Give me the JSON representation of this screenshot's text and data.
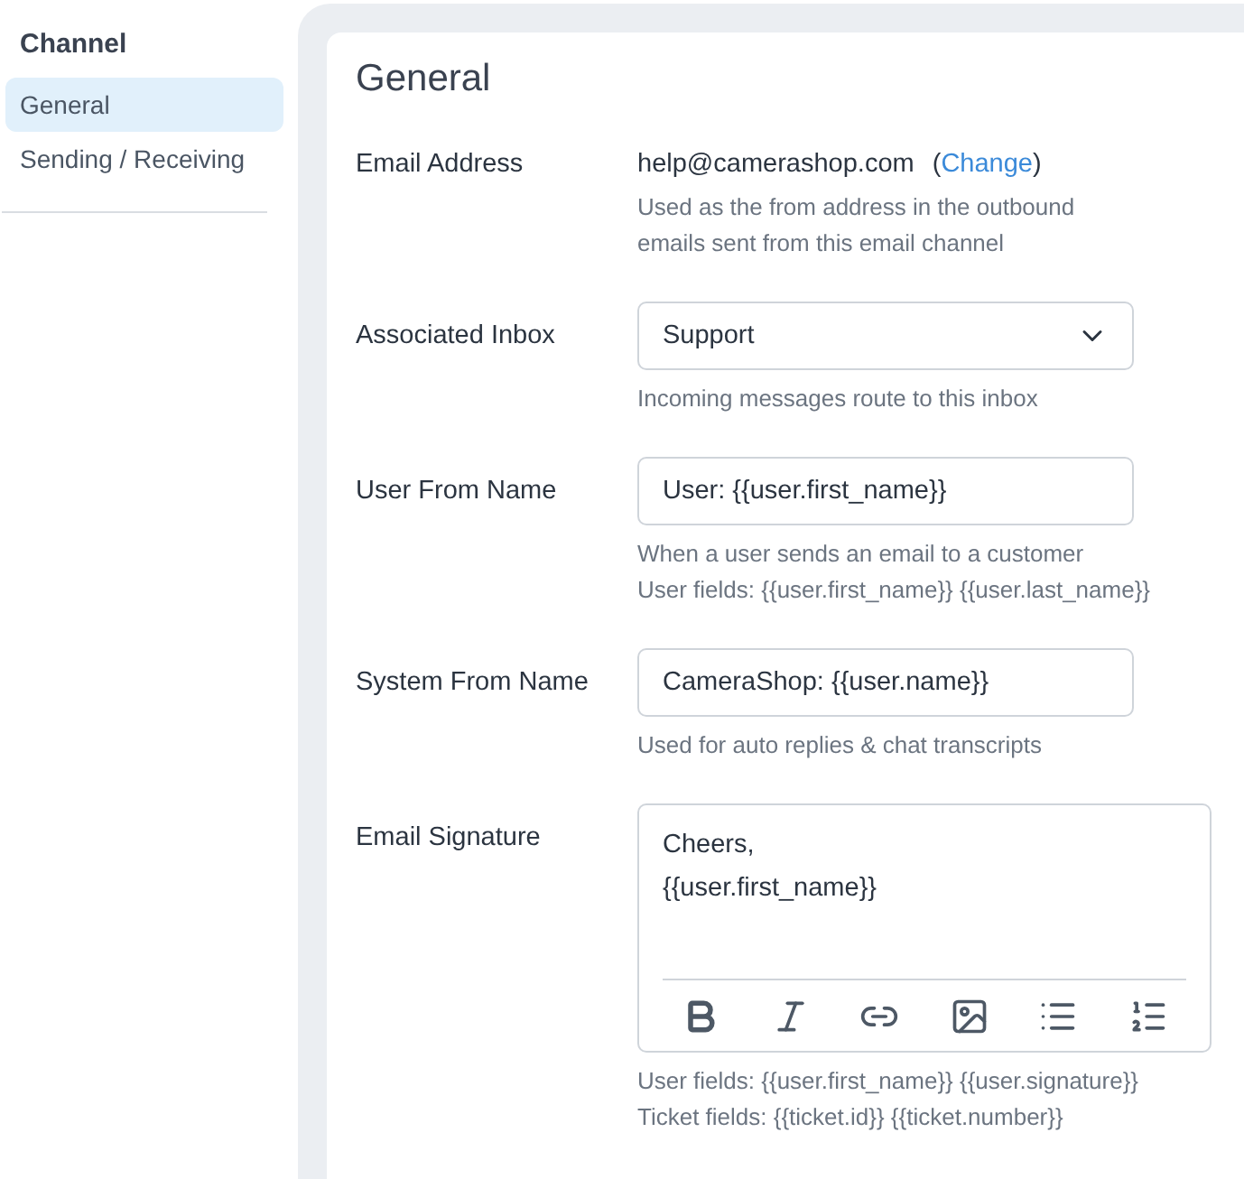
{
  "sidebar": {
    "title": "Channel",
    "items": [
      {
        "label": "General",
        "selected": true
      },
      {
        "label": "Sending / Receiving",
        "selected": false
      }
    ]
  },
  "panel": {
    "title": "General",
    "fields": [
      {
        "kind": "text",
        "label": "Email Address",
        "value": "help@camerashop.com",
        "paren_open": "(",
        "link": "Change",
        "paren_close": ")",
        "help": [
          "Used as the from address in the outbound",
          "emails sent from this email channel"
        ]
      },
      {
        "kind": "select",
        "label": "Associated Inbox",
        "value": "Support",
        "help": [
          "Incoming messages route to this inbox"
        ]
      },
      {
        "kind": "input",
        "label": "User From Name",
        "value": "User: {{user.first_name}}",
        "help": [
          "When a user sends an email to a customer",
          "User fields: {{user.first_name}} {{user.last_name}}"
        ]
      },
      {
        "kind": "input",
        "label": "System From Name",
        "value": "CameraShop: {{user.name}}",
        "help": [
          "Used for auto replies & chat transcripts"
        ]
      },
      {
        "kind": "editor",
        "label": "Email Signature",
        "lines": [
          "Cheers,",
          "{{user.first_name}}"
        ],
        "help": [
          "User fields: {{user.first_name}} {{user.signature}}",
          "Ticket fields: {{ticket.id}} {{ticket.number}}"
        ]
      }
    ]
  }
}
